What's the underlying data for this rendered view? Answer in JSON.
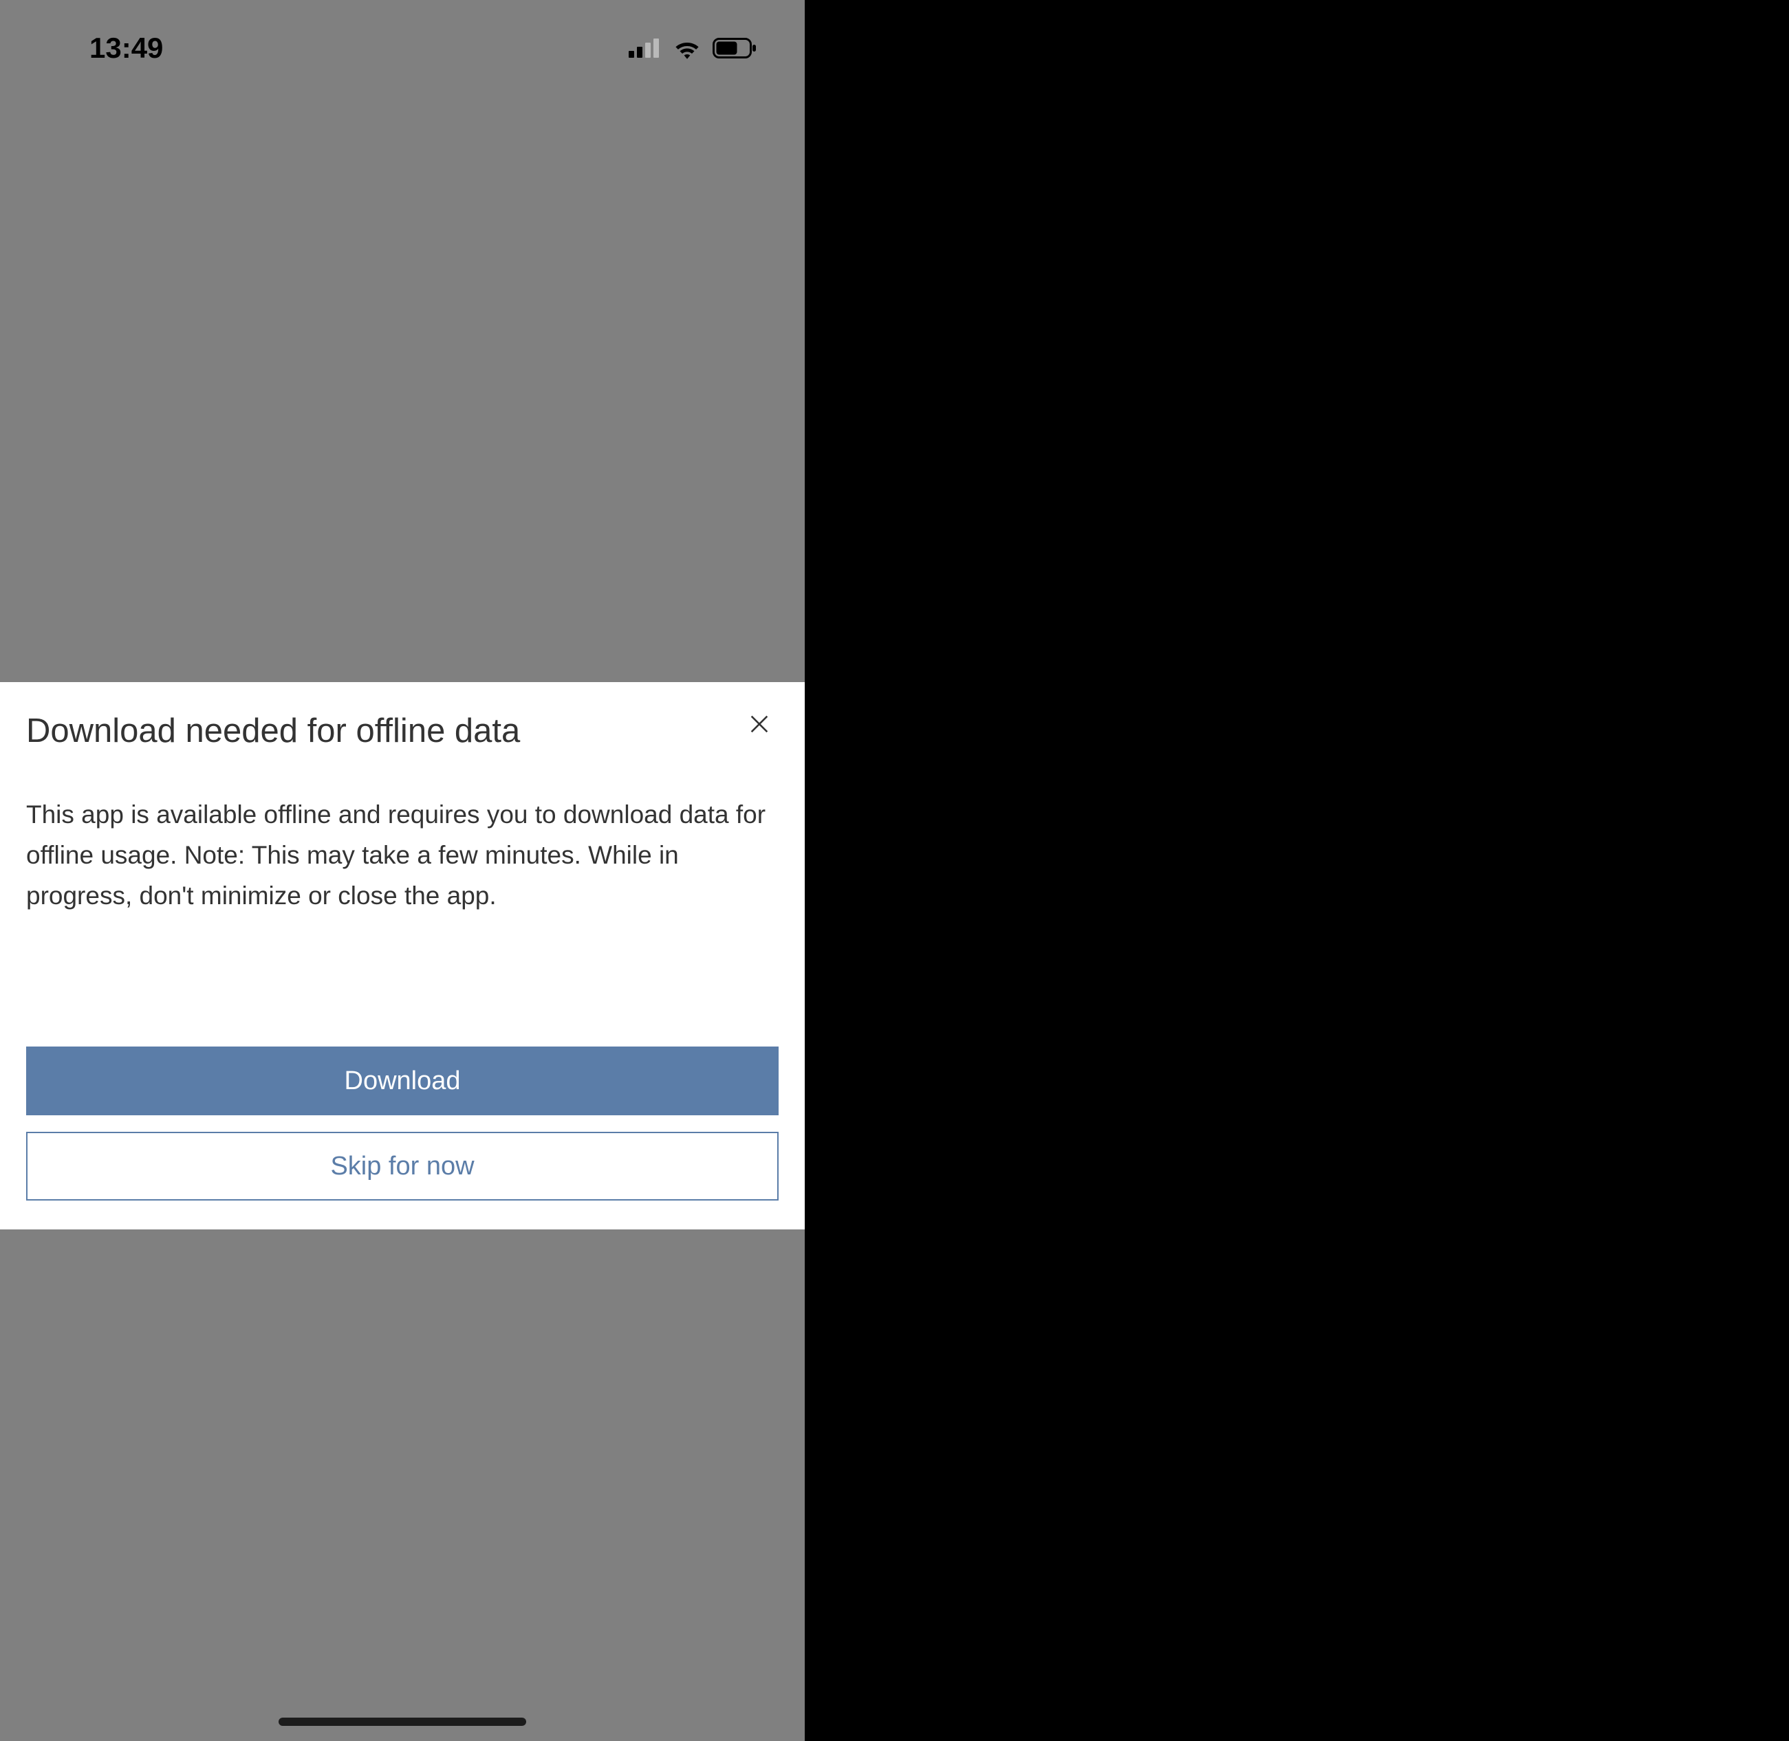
{
  "statusbar": {
    "time": "13:49"
  },
  "modal": {
    "title": "Download needed for offline data",
    "body": "This app is available offline and requires you to download data for offline usage. Note: This may take a few minutes. While in progress, don't minimize or close the app.",
    "primary_label": "Download",
    "secondary_label": "Skip for now"
  }
}
